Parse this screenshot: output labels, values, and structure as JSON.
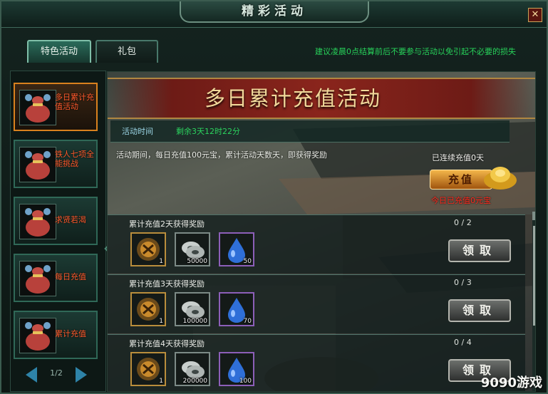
{
  "window": {
    "title": "精彩活动",
    "close_label": "✕"
  },
  "tabs": [
    {
      "label": "特色活动",
      "active": true
    },
    {
      "label": "礼包",
      "active": false
    }
  ],
  "notice": "建议凌晨0点结算前后不要参与活动以免引起不必要的损失",
  "sidebar": {
    "items": [
      {
        "label": "多日累计充值活动",
        "selected": true
      },
      {
        "label": "铁人七项全能挑战",
        "selected": false
      },
      {
        "label": "求贤若渴",
        "selected": false
      },
      {
        "label": "每日充值",
        "selected": false
      },
      {
        "label": "累计充值",
        "selected": false
      }
    ],
    "page": "1/2"
  },
  "main": {
    "banner_title": "多日累计充值活动",
    "time_label": "活动时间",
    "time_remaining": "剩余3天12时22分",
    "description": "活动期间，每日充值100元宝，累计活动天数天，即获得奖励",
    "consecutive": "已连续充值0天",
    "charge_button": "充值",
    "today_charged": "今日已充值0元宝",
    "rows": [
      {
        "title": "累计充值2天获得奖励",
        "progress": "0 / 2",
        "rewards": [
          {
            "icon": "bag-reward-icon",
            "count": "1"
          },
          {
            "icon": "silver-coin-icon",
            "count": "50000"
          },
          {
            "icon": "blue-drop-icon",
            "count": "50"
          }
        ],
        "claim": "领取"
      },
      {
        "title": "累计充值3天获得奖励",
        "progress": "0 / 3",
        "rewards": [
          {
            "icon": "bag-reward-icon",
            "count": "1"
          },
          {
            "icon": "silver-coin-icon",
            "count": "100000"
          },
          {
            "icon": "blue-drop-icon",
            "count": "70"
          }
        ],
        "claim": "领取"
      },
      {
        "title": "累计充值4天获得奖励",
        "progress": "0 / 4",
        "rewards": [
          {
            "icon": "bag-reward-icon",
            "count": "1"
          },
          {
            "icon": "silver-coin-icon",
            "count": "200000"
          },
          {
            "icon": "blue-drop-icon",
            "count": "100"
          }
        ],
        "claim": "领取"
      }
    ]
  },
  "watermark": "9090游戏"
}
